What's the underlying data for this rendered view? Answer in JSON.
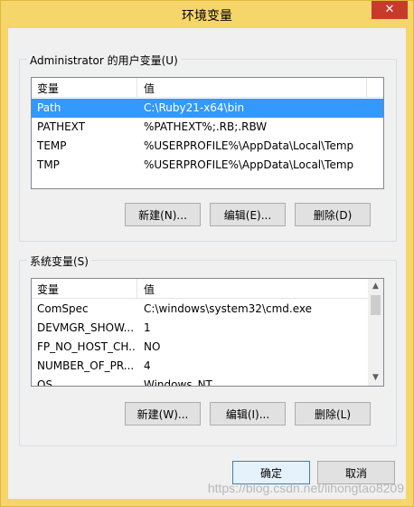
{
  "window": {
    "title": "环境变量",
    "close_glyph": "✕"
  },
  "user_vars": {
    "group_label": "Administrator 的用户变量(U)",
    "col_var": "变量",
    "col_val": "值",
    "rows": [
      {
        "var": "Path",
        "val": "C:\\Ruby21-x64\\bin",
        "selected": true
      },
      {
        "var": "PATHEXT",
        "val": "%PATHEXT%;.RB;.RBW"
      },
      {
        "var": "TEMP",
        "val": "%USERPROFILE%\\AppData\\Local\\Temp"
      },
      {
        "var": "TMP",
        "val": "%USERPROFILE%\\AppData\\Local\\Temp"
      }
    ],
    "new_label": "新建(N)...",
    "edit_label": "编辑(E)...",
    "delete_label": "删除(D)"
  },
  "system_vars": {
    "group_label": "系统变量(S)",
    "col_var": "变量",
    "col_val": "值",
    "rows": [
      {
        "var": "ComSpec",
        "val": "C:\\windows\\system32\\cmd.exe"
      },
      {
        "var": "DEVMGR_SHOW...",
        "val": "1"
      },
      {
        "var": "FP_NO_HOST_CH...",
        "val": "NO"
      },
      {
        "var": "NUMBER_OF_PR...",
        "val": "4"
      },
      {
        "var": "OS",
        "val": "Windows_NT"
      }
    ],
    "new_label": "新建(W)...",
    "edit_label": "编辑(I)...",
    "delete_label": "删除(L)"
  },
  "footer": {
    "ok_label": "确定",
    "cancel_label": "取消"
  },
  "watermark": "https://blog.csdn.net/lihongtao8209"
}
